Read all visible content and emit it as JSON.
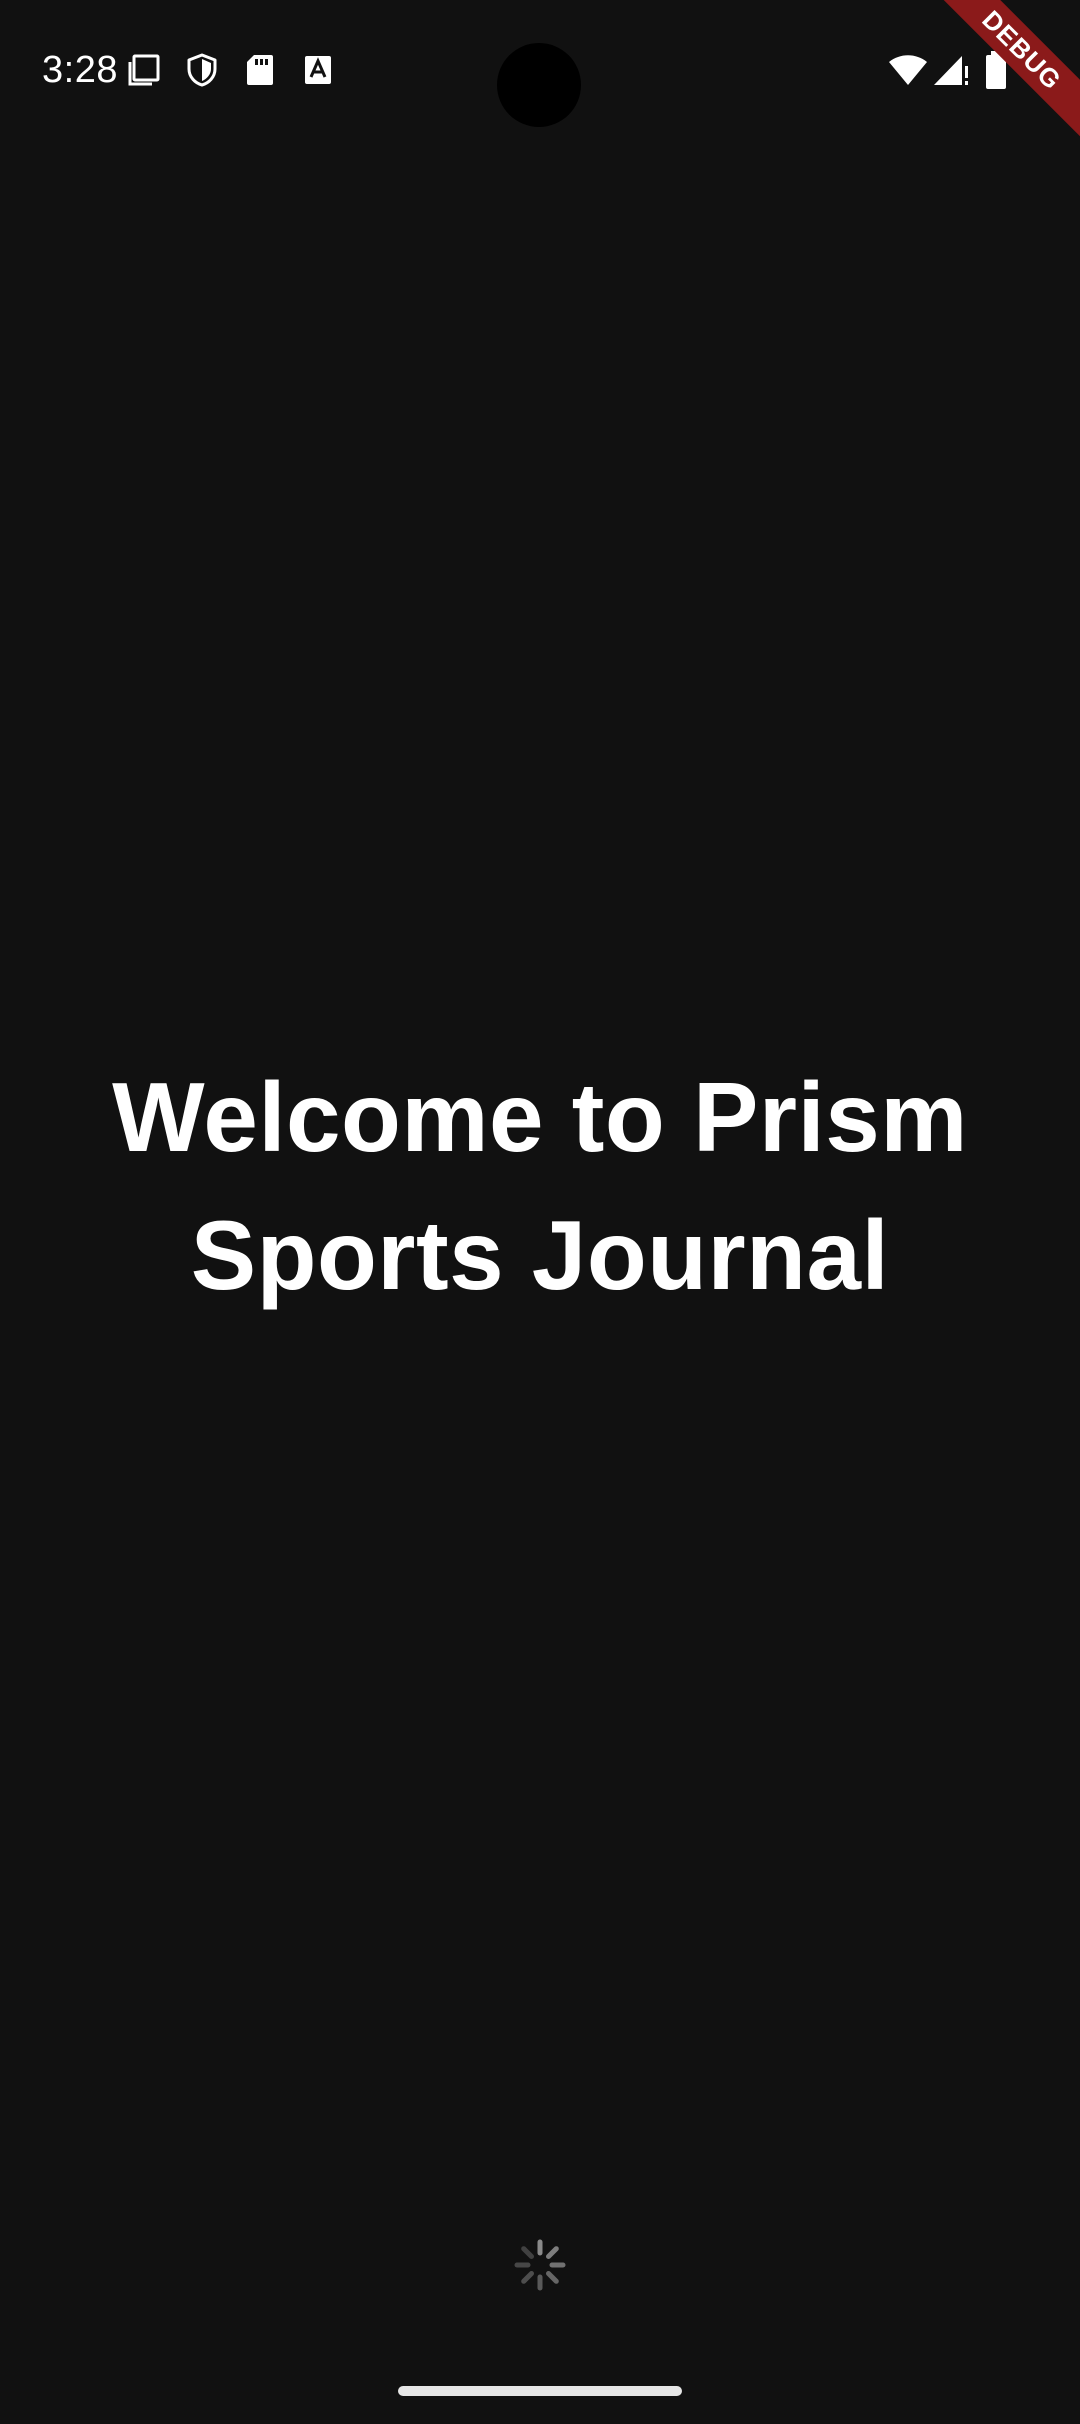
{
  "status_bar": {
    "time": "3:28",
    "left_icons": [
      "screenshot-icon",
      "shield-icon",
      "sd-card-icon",
      "font-a-icon"
    ],
    "right_icons": [
      "wifi-icon",
      "cellular-signal-icon",
      "battery-icon"
    ]
  },
  "debug_banner": {
    "label": "DEBUG",
    "color": "#8b1a1a"
  },
  "main": {
    "title_line1": "Welcome to Prism",
    "title_line2": "Sports Journal"
  },
  "colors": {
    "background": "#111111",
    "text": "#ffffff",
    "spinner": "#8a8a8a"
  }
}
